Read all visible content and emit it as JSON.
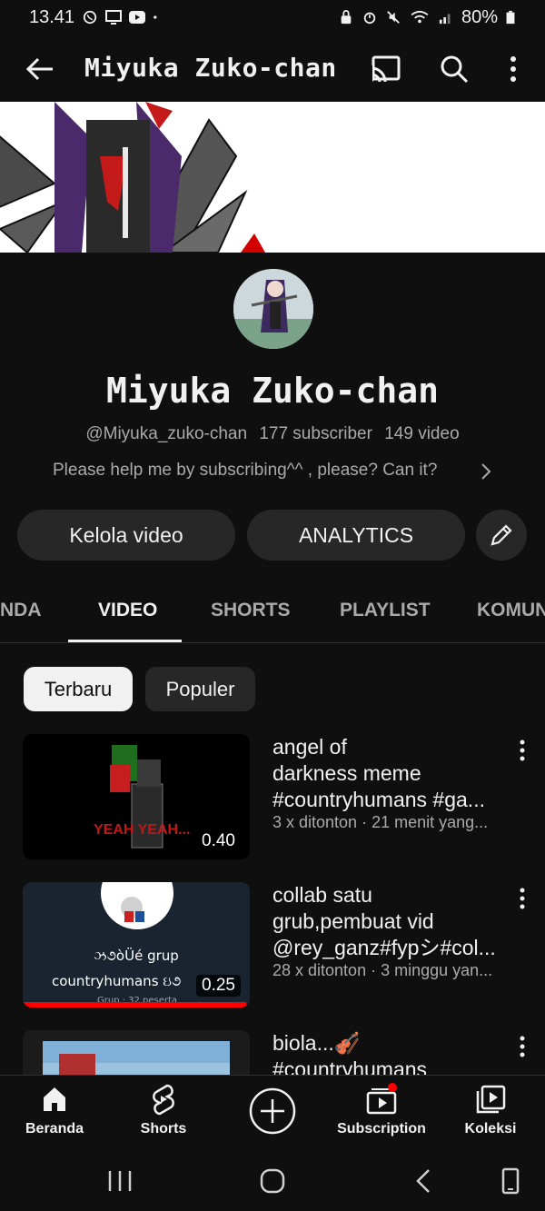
{
  "status_bar": {
    "time": "13.41",
    "battery": "80%"
  },
  "app_bar": {
    "title": "Miyuka Zuko-chan"
  },
  "channel": {
    "name": "Miyuka Zuko-chan",
    "handle": "@Miyuka_zuko-chan",
    "subscribers": "177 subscriber",
    "videos": "149 video",
    "description": "Please help me by subscribing^^ , please? Can it?"
  },
  "actions": {
    "manage": "Kelola video",
    "analytics": "ANALYTICS"
  },
  "tabs": [
    {
      "label": "NDA"
    },
    {
      "label": "VIDEO"
    },
    {
      "label": "SHORTS"
    },
    {
      "label": "PLAYLIST"
    },
    {
      "label": "KOMUN"
    }
  ],
  "filters": {
    "latest": "Terbaru",
    "popular": "Populer"
  },
  "videos": [
    {
      "title_lines": [
        "angel of",
        "darkness meme",
        "#countryhumans #ga..."
      ],
      "meta": "3 x ditonton · 21 menit yang...",
      "duration": "0.40",
      "thumb_text": "YEAH YEAH..."
    },
    {
      "title_lines": [
        "collab satu",
        "grub,pembuat vid",
        "@rey_ganz#fypシ#col..."
      ],
      "meta": "28 x ditonton · 3 minggu yan...",
      "duration": "0.25",
      "thumb_text": "ઝ૭ὸÜé grup",
      "thumb_text2": "countryhumans ઇ૭",
      "thumb_text3": "Grup · 32 peserta"
    },
    {
      "title_lines": [
        "biola...🎻",
        "#countryhumans"
      ],
      "meta": "",
      "duration": ""
    }
  ],
  "nav": [
    {
      "label": "Beranda",
      "icon": "home-icon"
    },
    {
      "label": "Shorts",
      "icon": "shorts-icon"
    },
    {
      "label": "",
      "icon": "create-icon"
    },
    {
      "label": "Subscription",
      "icon": "subscriptions-icon"
    },
    {
      "label": "Koleksi",
      "icon": "library-icon"
    }
  ],
  "colors": {
    "background": "#0f0f0f",
    "chip_active": "#f1f1f1",
    "button_bg": "#272727",
    "notification": "#ff0000",
    "progress": "#ff0000"
  }
}
